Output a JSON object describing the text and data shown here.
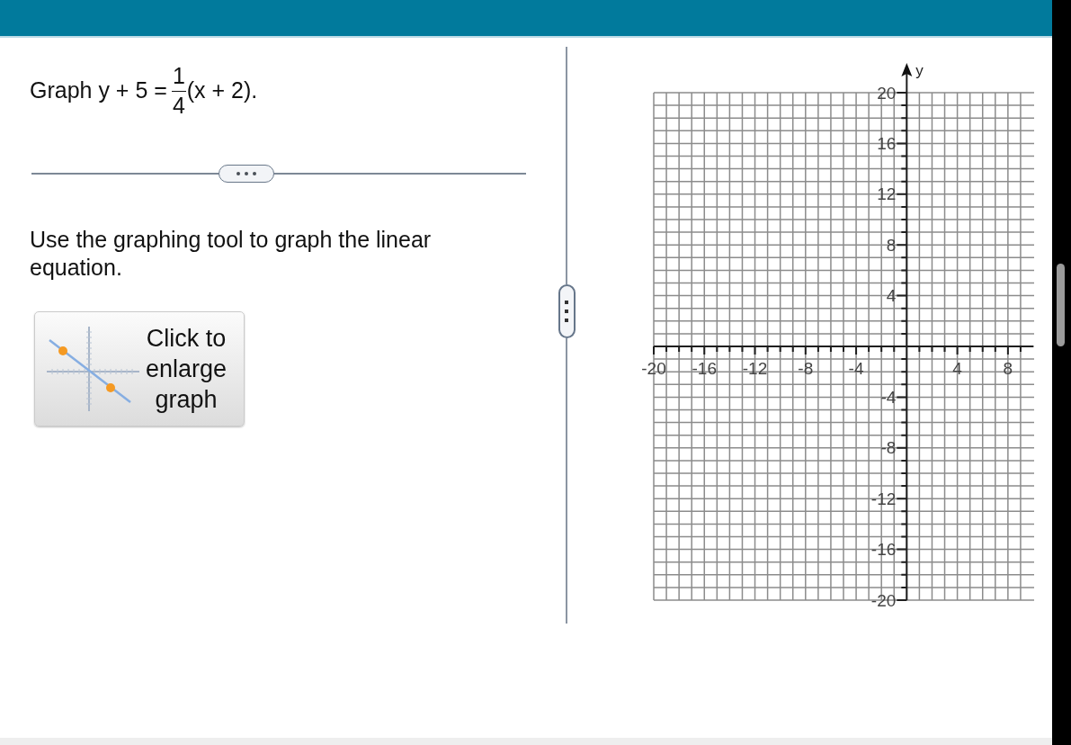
{
  "question": {
    "lead": "Graph y + 5 =",
    "numerator": "1",
    "denominator": "4",
    "tail": "(x + 2)."
  },
  "instruction": "Use the graphing tool to graph the linear equation.",
  "enlarge_button": {
    "label": "Click to enlarge graph"
  },
  "graph": {
    "chart_data": {
      "type": "line",
      "grid": true,
      "ylabel": "y",
      "xlim": [
        -20,
        10
      ],
      "ylim": [
        -20,
        20
      ],
      "xticks": [
        -20,
        -16,
        -12,
        -8,
        -4,
        4,
        8
      ],
      "yticks": [
        20,
        16,
        12,
        8,
        4,
        -4,
        -8,
        -12,
        -16,
        -20
      ]
    }
  }
}
